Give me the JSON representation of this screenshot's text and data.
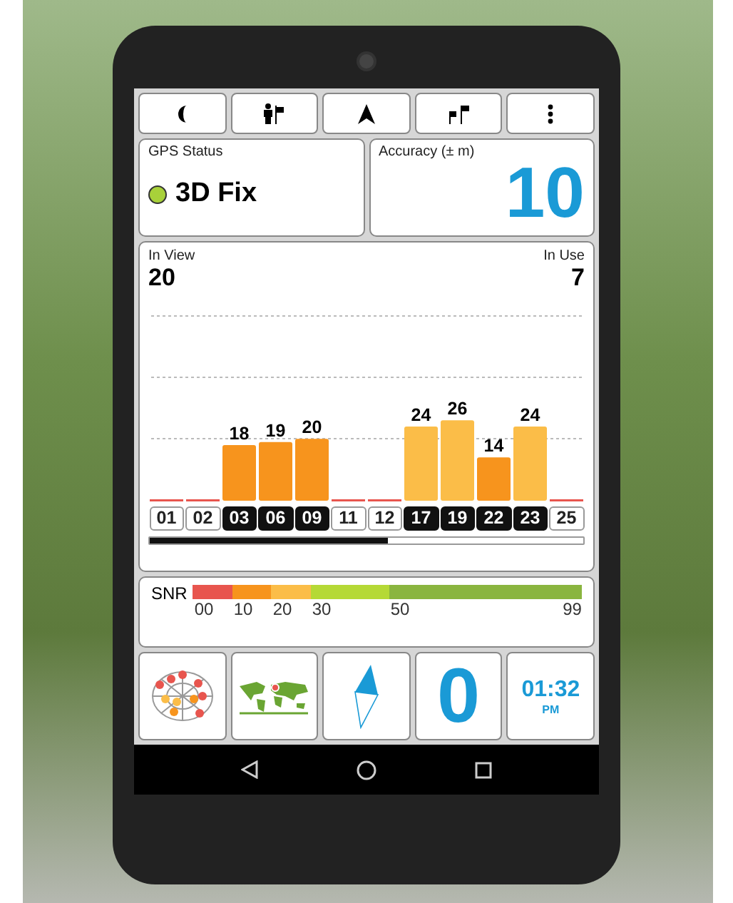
{
  "toolbar": [
    {
      "kind": "moon"
    },
    {
      "kind": "person_flag"
    },
    {
      "kind": "arrow"
    },
    {
      "kind": "flags"
    },
    {
      "kind": "menu"
    }
  ],
  "gps_status": {
    "label": "GPS Status",
    "value": "3D Fix",
    "color": "#a8d13a"
  },
  "accuracy": {
    "label": "Accuracy (± m)",
    "value": "10"
  },
  "satellites": {
    "in_view_label": "In View",
    "in_view": "20",
    "in_use_label": "In Use",
    "in_use": "7",
    "chart_data": {
      "type": "bar",
      "categories": [
        "01",
        "02",
        "03",
        "06",
        "09",
        "11",
        "12",
        "17",
        "19",
        "22",
        "23",
        "25"
      ],
      "data_labels": true,
      "series": [
        {
          "values": [
            null,
            null,
            18,
            19,
            20,
            null,
            null,
            24,
            26,
            14,
            24,
            null
          ]
        }
      ]
    },
    "used": [
      false,
      false,
      true,
      true,
      true,
      false,
      false,
      true,
      true,
      true,
      true,
      false
    ]
  },
  "snr_scale": {
    "label": "SNR",
    "segments": [
      {
        "from": "00",
        "color": "#e8554e"
      },
      {
        "from": "10",
        "color": "#f7941d"
      },
      {
        "from": "20",
        "color": "#fbbd48"
      },
      {
        "from": "30",
        "color": "#b5d936"
      },
      {
        "from": "50",
        "color": "#8ab53f"
      }
    ],
    "end": "99"
  },
  "tiles": [
    {
      "kind": "skyplot"
    },
    {
      "kind": "map"
    },
    {
      "kind": "compass"
    },
    {
      "kind": "number",
      "value": "0"
    },
    {
      "kind": "clock",
      "time": "01:32",
      "period": "PM"
    }
  ]
}
